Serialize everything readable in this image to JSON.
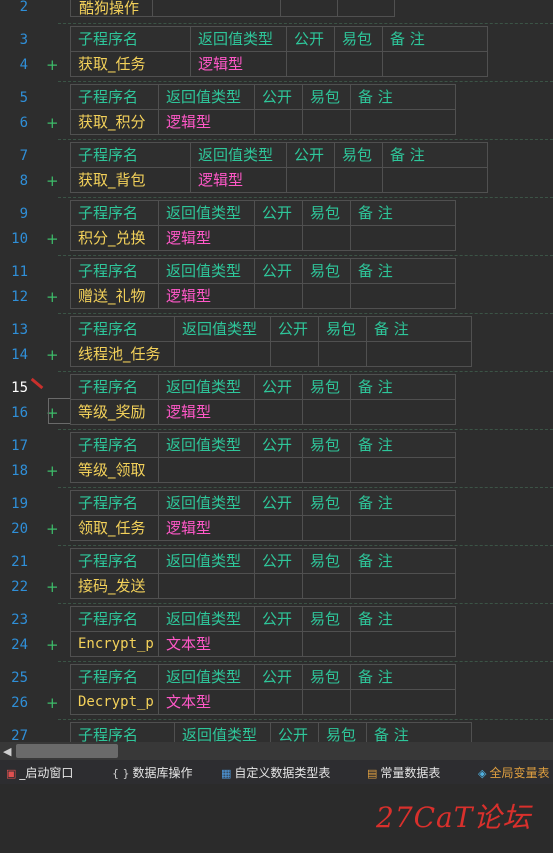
{
  "headers": {
    "name": "子程序名",
    "ret": "返回值类型",
    "public": "公开",
    "easy": "易包",
    "note": "备 注"
  },
  "top_row": {
    "line": "2",
    "name": "酷狗操作"
  },
  "subs": [
    {
      "l1": "3",
      "l2": "4",
      "name": "获取_任务",
      "type": "逻辑型",
      "layout": "b"
    },
    {
      "l1": "5",
      "l2": "6",
      "name": "获取_积分",
      "type": "逻辑型",
      "layout": "a"
    },
    {
      "l1": "7",
      "l2": "8",
      "name": "获取_背包",
      "type": "逻辑型",
      "layout": "b"
    },
    {
      "l1": "9",
      "l2": "10",
      "name": "积分_兑换",
      "type": "逻辑型",
      "layout": "a"
    },
    {
      "l1": "11",
      "l2": "12",
      "name": "赠送_礼物",
      "type": "逻辑型",
      "layout": "a"
    },
    {
      "l1": "13",
      "l2": "14",
      "name": "线程池_任务",
      "type": "",
      "layout": "c"
    },
    {
      "l1": "15",
      "l2": "16",
      "name": "等级_奖励",
      "type": "逻辑型",
      "layout": "a",
      "current": true
    },
    {
      "l1": "17",
      "l2": "18",
      "name": "等级_领取",
      "type": "",
      "layout": "a"
    },
    {
      "l1": "19",
      "l2": "20",
      "name": "领取_任务",
      "type": "逻辑型",
      "layout": "a"
    },
    {
      "l1": "21",
      "l2": "22",
      "name": "接码_发送",
      "type": "",
      "layout": "a"
    },
    {
      "l1": "23",
      "l2": "24",
      "name": "Encrypt_p",
      "type": "文本型",
      "layout": "a",
      "mono": true
    },
    {
      "l1": "25",
      "l2": "26",
      "name": "Decrypt_p",
      "type": "文本型",
      "layout": "a",
      "mono": true
    },
    {
      "l1": "27",
      "l2": "",
      "name": "",
      "type": "",
      "layout": "c",
      "partial": true
    }
  ],
  "plus_sign": "+",
  "tabs": [
    {
      "icon": "window-icon",
      "glyph": "▣",
      "color": "#e05050",
      "label": "_启动窗口"
    },
    {
      "icon": "braces-icon",
      "glyph": "{ }",
      "color": "#cfcfcf",
      "label": "数据库操作"
    },
    {
      "icon": "table-icon",
      "glyph": "▦",
      "color": "#4f9be0",
      "label": "自定义数据类型表"
    },
    {
      "icon": "constants-icon",
      "glyph": "▤",
      "color": "#e0a040",
      "label": "常量数据表"
    },
    {
      "icon": "globals-icon",
      "glyph": "◈",
      "color": "#4fb0e0",
      "label": "全局变量表"
    }
  ],
  "watermark": "27CaT论坛"
}
